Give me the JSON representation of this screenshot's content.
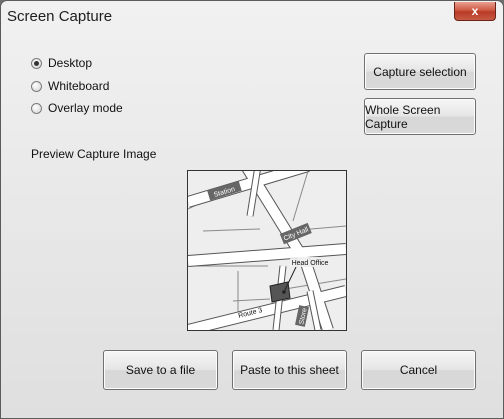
{
  "window": {
    "title": "Screen Capture",
    "close_label": "x"
  },
  "mode_options": [
    {
      "label": "Desktop",
      "checked": true
    },
    {
      "label": "Whiteboard",
      "checked": false
    },
    {
      "label": "Overlay mode",
      "checked": false
    }
  ],
  "buttons": {
    "capture_selection": "Capture selection",
    "whole_screen": "Whole Screen Capture",
    "save_file": "Save to a file",
    "paste_sheet": "Paste to this sheet",
    "cancel": "Cancel"
  },
  "preview": {
    "label": "Preview Capture Image",
    "map_labels": {
      "station": "Station",
      "city_hall": "City Hall",
      "head_office": "Head Office",
      "route": "Route 3",
      "store": "Store"
    }
  }
}
